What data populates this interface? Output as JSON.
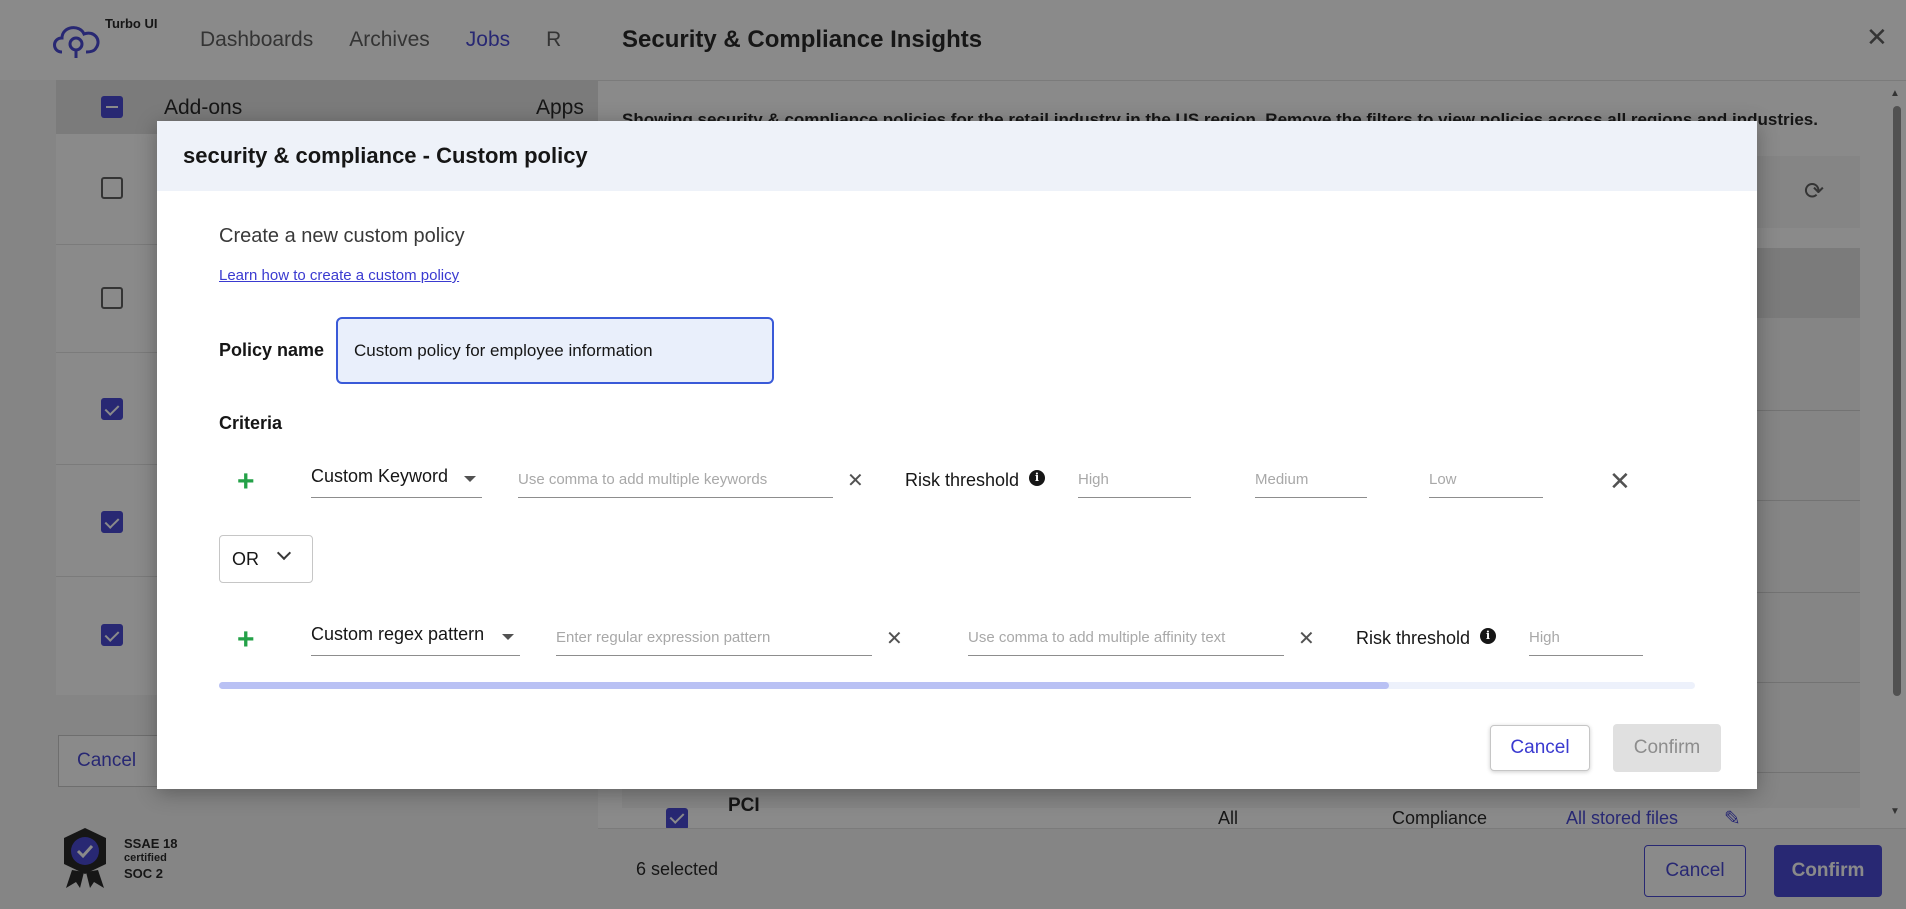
{
  "app": {
    "logo_text": "Turbo UI",
    "nav": [
      "Dashboards",
      "Archives",
      "Jobs",
      "R"
    ]
  },
  "background_table": {
    "header_addons": "Add-ons",
    "header_apps": "Apps",
    "cancel_label": "Cancel",
    "badge_line1": "SSAE 18",
    "badge_line2": "certified",
    "badge_line3": "SOC 2"
  },
  "side_panel": {
    "title": "Security & Compliance Insights",
    "description": "Showing security & compliance policies for the retail industry in the US region. Remove the filters to view policies across all regions and industries.",
    "row": {
      "name": "PCI",
      "scope": "All",
      "type": "Compliance",
      "target": "All stored files"
    },
    "selected_count": "6 selected",
    "cancel_label": "Cancel",
    "confirm_label": "Confirm"
  },
  "modal": {
    "title": "security & compliance - Custom policy",
    "subtitle": "Create a new custom policy",
    "learn_link": "Learn how to create a custom policy",
    "policy_name_label": "Policy name",
    "policy_name_value": "Custom policy for employee information",
    "criteria_label": "Criteria",
    "criteria_row1": {
      "type": "Custom Keyword",
      "keywords_placeholder": "Use comma to add multiple keywords",
      "risk_label": "Risk threshold",
      "high_placeholder": "High",
      "medium_placeholder": "Medium",
      "low_placeholder": "Low"
    },
    "operator": "OR",
    "criteria_row2": {
      "type": "Custom regex pattern",
      "regex_placeholder": "Enter regular expression pattern",
      "affinity_placeholder": "Use comma to add multiple affinity text",
      "risk_label": "Risk threshold",
      "high_placeholder": "High"
    },
    "cancel_label": "Cancel",
    "confirm_label": "Confirm"
  },
  "colors": {
    "accent": "#3a3ad0",
    "add_green": "#24a148",
    "focus_border": "#3a5ad8"
  }
}
